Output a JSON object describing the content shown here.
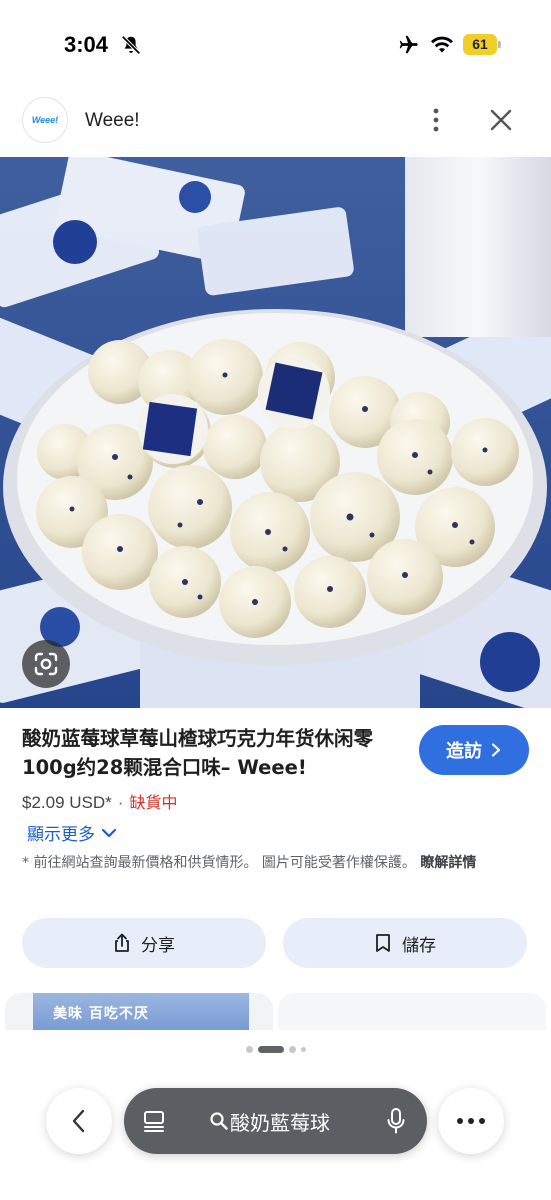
{
  "status_bar": {
    "time": "3:04",
    "battery": "61",
    "icons": [
      "bell-slash-icon",
      "airplane-icon",
      "wifi-icon",
      "battery-icon"
    ]
  },
  "site": {
    "logo_text": "Weee!",
    "name": "Weee!"
  },
  "product": {
    "title": "酸奶蓝莓球草莓山楂球巧克力年货休闲零100g约28颗混合口味– Weee!",
    "visit_label": "造訪",
    "price": "$2.09 USD*",
    "separator": "·",
    "stock_status": "缺貨中",
    "see_more": "顯示更多",
    "disclaimer": "* 前往網站查詢最新價格和供貨情形。 圖片可能受著作權保護。",
    "disclaimer_link": "瞭解詳情"
  },
  "actions": {
    "share_label": "分享",
    "save_label": "儲存"
  },
  "related": {
    "card1_caption": "美味 百吃不厌"
  },
  "pager": {
    "count": 4,
    "active_index": 1
  },
  "toolbar": {
    "search_query": "酸奶藍莓球"
  },
  "colors": {
    "accent": "#2f6fe0",
    "stock_red": "#d93025",
    "link_blue": "#1a5fd0",
    "battery_yellow": "#f0cf2a"
  }
}
